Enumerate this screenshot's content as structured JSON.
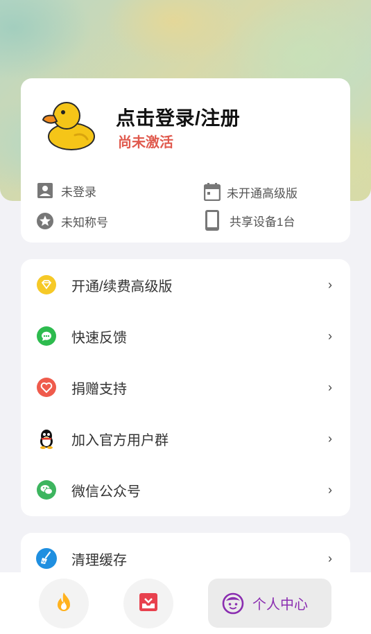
{
  "profile": {
    "login_title": "点击登录/注册",
    "activation_status": "尚未激活",
    "login_status": "未登录",
    "nickname": "未知称号",
    "plan_status": "未开通高级版",
    "devices": "共享设备1台"
  },
  "menu": {
    "items": [
      {
        "label": "开通/续费高级版",
        "icon": "diamond-icon"
      },
      {
        "label": "快速反馈",
        "icon": "chat-icon"
      },
      {
        "label": "捐赠支持",
        "icon": "heart-icon"
      },
      {
        "label": "加入官方用户群",
        "icon": "qq-penguin-icon"
      },
      {
        "label": "微信公众号",
        "icon": "wechat-icon"
      }
    ],
    "chevron": "›"
  },
  "clear_cache": {
    "label": "清理缓存",
    "icon": "broom-icon"
  },
  "tabbar": {
    "tabs": [
      {
        "icon": "flame-icon"
      },
      {
        "icon": "inbox-download-icon"
      },
      {
        "icon": "face-icon",
        "label": "个人中心",
        "active": true
      }
    ]
  },
  "colors": {
    "accent_purple": "#8a2db0",
    "activation_red": "#e05a4e"
  }
}
